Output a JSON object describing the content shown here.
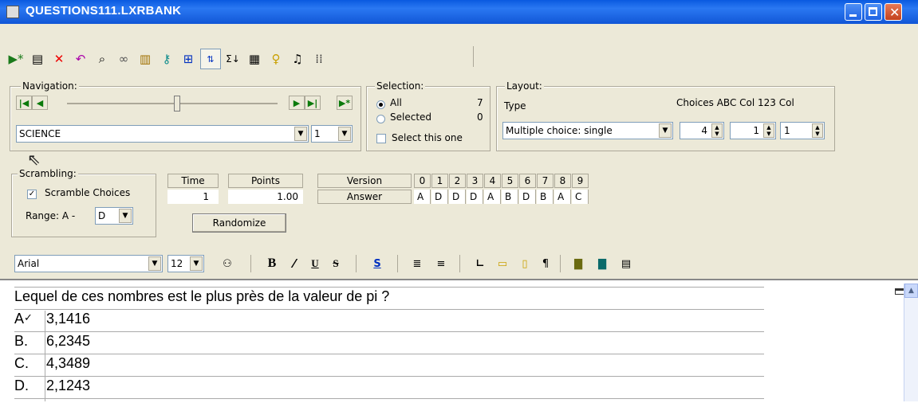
{
  "window": {
    "title": "QUESTIONS111.LXRBANK"
  },
  "toolbar": {
    "icons": [
      "add-record-icon",
      "list-icon",
      "delete-icon",
      "undo-icon",
      "find-icon",
      "link-icon",
      "book-icon",
      "key-icon",
      "grid-icon",
      "sort-icon",
      "sum-icon",
      "form-icon",
      "bulb-icon",
      "music-icon",
      "dots-icon"
    ]
  },
  "navigation": {
    "legend": "Navigation:",
    "category": "SCIENCE",
    "number": "1"
  },
  "selection": {
    "legend": "Selection:",
    "all_label": "All",
    "all_count": "7",
    "selected_label": "Selected",
    "selected_count": "0",
    "select_one_label": "Select this one",
    "mode": "All"
  },
  "layout": {
    "legend": "Layout:",
    "type_label": "Type",
    "cols_label": "Choices ABC Col 123 Col",
    "type_value": "Multiple choice: single",
    "choices": "4",
    "abc_col": "1",
    "num_col": "1"
  },
  "scrambling": {
    "legend": "Scrambling:",
    "scramble_label": "Scramble Choices",
    "scramble_checked": true,
    "range_label": "Range: A -",
    "range_value": "D"
  },
  "time": {
    "label": "Time",
    "value": "1"
  },
  "points": {
    "label": "Points",
    "value": "1.00"
  },
  "versions": {
    "version_label": "Version",
    "answer_label": "Answer",
    "numbers": [
      "0",
      "1",
      "2",
      "3",
      "4",
      "5",
      "6",
      "7",
      "8",
      "9"
    ],
    "answers": [
      "A",
      "D",
      "D",
      "D",
      "A",
      "B",
      "D",
      "B",
      "A",
      "C"
    ]
  },
  "randomize_label": "Randomize",
  "format": {
    "font": "Arial",
    "size": "12"
  },
  "question": {
    "text": "Lequel de ces nombres est le plus près de la valeur de pi ?",
    "choices": [
      {
        "letter": "A",
        "text": "3,1416",
        "correct": true
      },
      {
        "letter": "B.",
        "text": "6,2345"
      },
      {
        "letter": "C.",
        "text": "4,3489"
      },
      {
        "letter": "D.",
        "text": "2,1243"
      }
    ],
    "correct_mark": "✓"
  }
}
